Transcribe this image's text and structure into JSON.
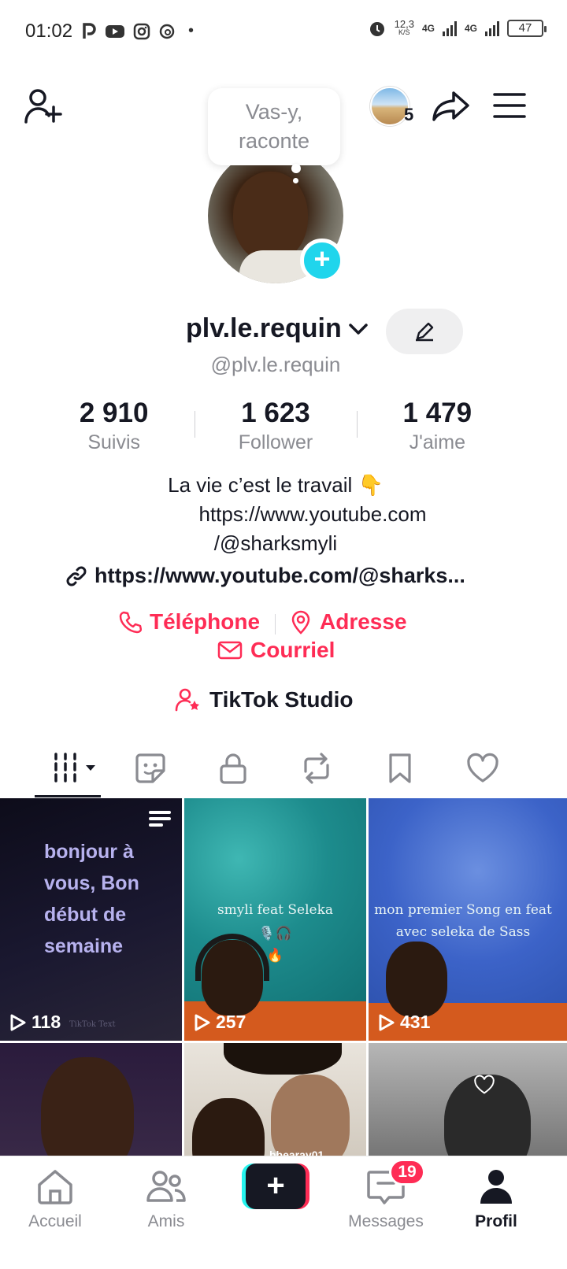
{
  "status_bar": {
    "time": "01:02",
    "speed_value": "12,3",
    "speed_unit": "K/S",
    "network1": "4G",
    "network2": "4G",
    "battery": "47",
    "dot": "•"
  },
  "header": {
    "story_count": "5"
  },
  "bubble": {
    "line1": "Vas-y,",
    "line2": "raconte"
  },
  "profile": {
    "display_name": "plv.le.requin",
    "username": "@plv.le.requin",
    "stats": [
      {
        "value": "2 910",
        "label": "Suivis"
      },
      {
        "value": "1 623",
        "label": "Follower"
      },
      {
        "value": "1 479",
        "label": "J'aime"
      }
    ],
    "bio_line1": "La vie c’est le travail 👇",
    "bio_line2": "https://www.youtube.com",
    "bio_line3": "/@sharksmyli",
    "link": "https://www.youtube.com/@sharks...",
    "contacts": {
      "phone": "Téléphone",
      "address": "Adresse",
      "email": "Courriel"
    },
    "studio": "TikTok Studio"
  },
  "videos": [
    {
      "views": "118",
      "text": "bonjour à vous, Bon début de semaine",
      "watermark": "TikTok Text"
    },
    {
      "views": "257",
      "caption1": "smyli feat Seleka",
      "caption2": "🎙️🎧",
      "caption3": "🔥"
    },
    {
      "views": "431",
      "caption1": "mon premier Song en feat",
      "caption2": "avec seleka de Sass"
    },
    {
      "views": ""
    },
    {
      "views": "",
      "caption1": "bbearay01"
    },
    {
      "views": ""
    }
  ],
  "bottom_nav": {
    "home": "Accueil",
    "friends": "Amis",
    "messages": "Messages",
    "messages_badge": "19",
    "profile": "Profil"
  },
  "colors": {
    "accent": "#fe2c55",
    "cyan": "#20d5ec",
    "text": "#161823",
    "muted": "#8a8b91"
  }
}
